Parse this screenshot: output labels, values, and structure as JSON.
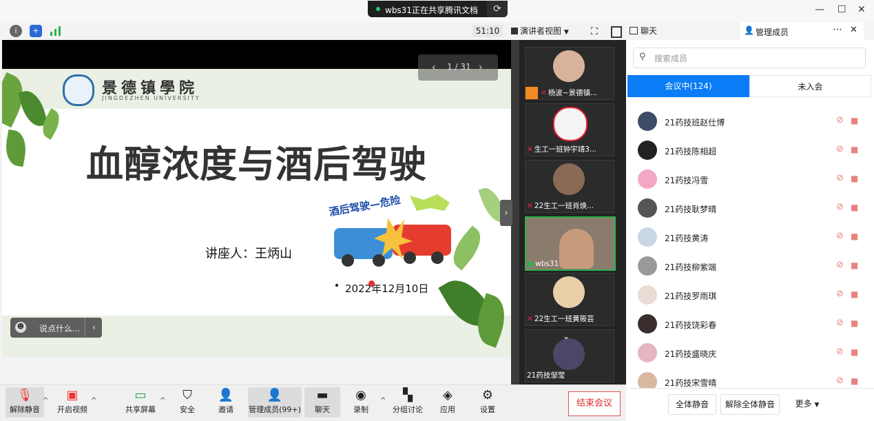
{
  "share_banner": {
    "text": "wbs31正在共享腾讯文档",
    "refresh_icon": "refresh-icon"
  },
  "window_controls": {
    "minimize": "—",
    "maximize": "☐",
    "close": "✕"
  },
  "top_toolbar": {
    "icons": [
      "info-icon",
      "shield-icon",
      "signal-icon"
    ],
    "timer": "51:10",
    "view_label": "演讲者视图",
    "fullscreen_icon": "fullscreen-icon",
    "sidebar_icon": "sidebar-toggle-icon"
  },
  "slide": {
    "pager": "1 / 31",
    "school_cn": "景德镇學院",
    "school_en": "JINGDEZHEN UNIVERSITY",
    "title": "血醇浓度与酒后驾驶",
    "speaker": "讲座人：王炳山",
    "date": "2022年12月10日",
    "cartoon_text": "酒后驾驶—危险",
    "chat_placeholder": "说点什么..."
  },
  "video_tiles": [
    {
      "name": "杨波~景德镇..."
    },
    {
      "name": "生工一班钟宇靖3..."
    },
    {
      "name": "22生工一班肖焕..."
    },
    {
      "name": "wbs31"
    },
    {
      "name": "22生工一班黄筱芸"
    },
    {
      "name": "21药技邹莹"
    }
  ],
  "panel": {
    "tab_chat": "聊天",
    "tab_members": "管理成员",
    "search_placeholder": "搜索成员",
    "tab_in_meeting": "会议中(124)",
    "tab_not_joined": "未入会",
    "members": [
      "21药技班赵仕博",
      "21药技陈相超",
      "21药技冯雪",
      "21药技耿梦晴",
      "21药技黄涛",
      "21药技柳紫端",
      "21药技罗雨琪",
      "21药技饶彩春",
      "21药技盛晓庆",
      "21药技宋雪晴"
    ],
    "btn_mute_all": "全体静音",
    "btn_unmute_all": "解除全体静音",
    "btn_more": "更多"
  },
  "bottom_toolbar": {
    "unmute": "解除静音",
    "start_video": "开启视频",
    "share_screen": "共享屏幕",
    "security": "安全",
    "invite": "邀请",
    "manage_members": "管理成员(99+)",
    "chat": "聊天",
    "record": "录制",
    "breakout": "分组讨论",
    "apps": "应用",
    "settings": "设置",
    "end_meeting": "结束会议"
  },
  "colors": {
    "accent": "#0a7cf5",
    "danger": "#e03030",
    "muted_icon": "#e8837f"
  }
}
